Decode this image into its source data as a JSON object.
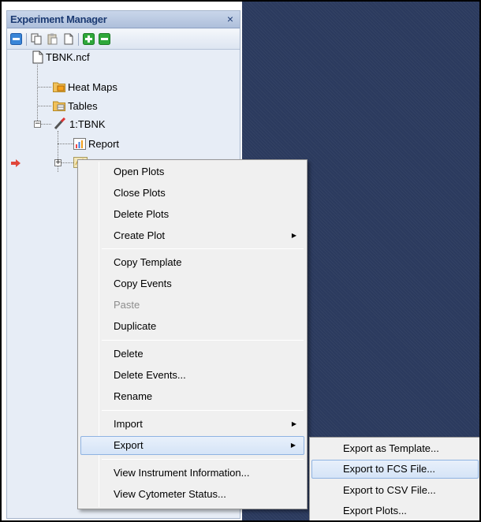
{
  "panel": {
    "title": "Experiment Manager",
    "close_glyph": "×",
    "toolbar_icons": [
      "collapse-icon",
      "copy-icon",
      "paste-icon",
      "document-icon",
      "add-icon",
      "remove-icon"
    ]
  },
  "tree": {
    "file": "TBNK.ncf",
    "heat_maps": "Heat Maps",
    "tables": "Tables",
    "experiment": "1:TBNK",
    "report": "Report",
    "selected_node": ""
  },
  "context_menu": {
    "items": [
      {
        "label": "Open Plots"
      },
      {
        "label": "Close Plots"
      },
      {
        "label": "Delete Plots"
      },
      {
        "label": "Create Plot",
        "submenu": true
      },
      {
        "label": "Copy Template"
      },
      {
        "label": "Copy Events"
      },
      {
        "label": "Paste",
        "disabled": true
      },
      {
        "label": "Duplicate"
      },
      {
        "label": "Delete"
      },
      {
        "label": "Delete Events..."
      },
      {
        "label": "Rename"
      },
      {
        "label": "Import",
        "submenu": true
      },
      {
        "label": "Export",
        "submenu": true,
        "highlighted": true
      },
      {
        "label": "View Instrument Information..."
      },
      {
        "label": "View Cytometer Status..."
      }
    ],
    "submenu_arrow": "▶"
  },
  "export_submenu": {
    "items": [
      {
        "label": "Export as Template..."
      },
      {
        "label": "Export to FCS File...",
        "highlighted": true
      },
      {
        "label": "Export to CSV File..."
      },
      {
        "label": "Export Plots..."
      }
    ]
  },
  "colors": {
    "panel_bg": "#e7edf6",
    "dark_area": "#2b3a5e",
    "highlight_border": "#8fb3e2",
    "pointer_arrow": "#e0463a"
  }
}
